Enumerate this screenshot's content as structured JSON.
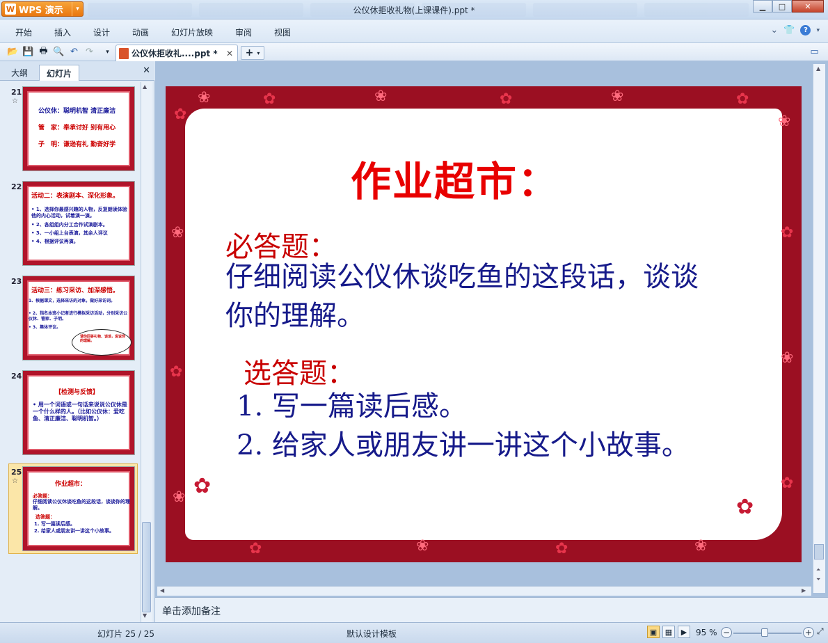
{
  "app": {
    "name": "WPS 演示",
    "window_title": "公仪休拒收礼物(上课课件).ppt *"
  },
  "menu": [
    "开始",
    "插入",
    "设计",
    "动画",
    "幻灯片放映",
    "审阅",
    "视图"
  ],
  "toolbar": {
    "doc_tab_label": "公仪休拒收礼....ppt *",
    "new_tab_label": "+"
  },
  "left_panel": {
    "tabs": [
      "大纲",
      "幻灯片"
    ],
    "thumbnails": [
      {
        "num": "21",
        "lines": [
          "公仪休：聪明机智 清正廉洁",
          "管　家：奉承讨好 别有用心",
          "子　明：谦逊有礼 勤奋好学"
        ]
      },
      {
        "num": "22",
        "lines": [
          "活动二：表演剧本、深化形象。",
          "• 1、选择你最感兴趣的人物，反复朗读体验他的内心活动，试着演一演。",
          "• 2、各组组内分工合作试演剧本。",
          "• 3、一小组上台表演，其余人评议",
          "• 4、根据评议再演。"
        ]
      },
      {
        "num": "23",
        "lines": [
          "活动三：练习采访、加深感悟。",
          "1、根据课文，选择采访的对象，做好采访词。",
          "• 2、指名本班小记者进行模拟采访活动，分别采访公仪休、管家、子明。",
          "• 3、集体评议。",
          "请你回答礼物、谈谈，说说你的理解。"
        ]
      },
      {
        "num": "24",
        "lines": [
          "【检测与反馈】",
          "• 用一个词语或一句话来说说公仪休是一个什么样的人。（比如公仪休：爱吃鱼、清正廉洁、聪明机智。）"
        ]
      },
      {
        "num": "25",
        "lines": [
          "作业超市：",
          "必答题：",
          "仔细阅读公仪休谈吃鱼的这段话，谈谈你的理解。",
          "选答题：",
          "1. 写一篇读后感。",
          "2. 给家人或朋友讲一讲这个小故事。"
        ]
      }
    ]
  },
  "slide": {
    "title": "作业超市：",
    "required_heading": "必答题：",
    "required_line1": "仔细阅读公仪休谈吃鱼的这段话，谈谈",
    "required_line2": "你的理解。",
    "optional_heading": "选答题：",
    "optional_item1": "1. 写一篇读后感。",
    "optional_item2": "2. 给家人或朋友讲一讲这个小故事。"
  },
  "notes_placeholder": "单击添加备注",
  "status": {
    "slide_counter": "幻灯片 25 / 25",
    "template": "默认设计模板",
    "zoom": "95 %"
  },
  "colors": {
    "accent": "#e9760e",
    "slide_border": "#9b0f22",
    "slide_title": "#e80000",
    "slide_heading": "#c80000",
    "slide_body": "#161a8a"
  }
}
